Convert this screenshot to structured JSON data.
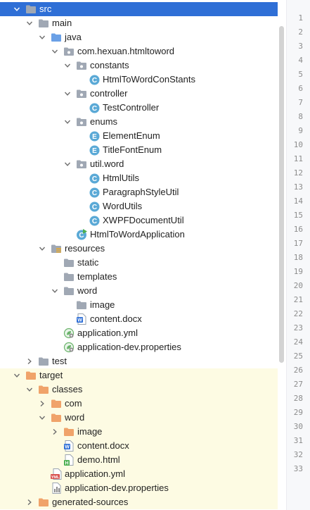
{
  "colors": {
    "selection": "#2f6fd6",
    "excluded_background": "#fdfbe3",
    "folder": "#a0a8b4",
    "source_folder": "#6aa0e6",
    "excluded_folder": "#f0a36a",
    "class_icon": "#5aa9d6",
    "enum_icon": "#5aa9d6",
    "gutter_background": "#f7f8fa",
    "line_number": "#8c8c8c"
  },
  "tree": [
    {
      "label": "src",
      "depth": 0,
      "expanded": true,
      "icon": "folder-icon",
      "state": "selected"
    },
    {
      "label": "main",
      "depth": 1,
      "expanded": true,
      "icon": "folder-icon"
    },
    {
      "label": "java",
      "depth": 2,
      "expanded": true,
      "icon": "source-folder-icon"
    },
    {
      "label": "com.hexuan.htmltoword",
      "depth": 3,
      "expanded": true,
      "icon": "package-icon"
    },
    {
      "label": "constants",
      "depth": 4,
      "expanded": true,
      "icon": "package-icon"
    },
    {
      "label": "HtmlToWordConStants",
      "depth": 5,
      "icon": "class-icon"
    },
    {
      "label": "controller",
      "depth": 4,
      "expanded": true,
      "icon": "package-icon"
    },
    {
      "label": "TestController",
      "depth": 5,
      "icon": "class-icon"
    },
    {
      "label": "enums",
      "depth": 4,
      "expanded": true,
      "icon": "package-icon"
    },
    {
      "label": "ElementEnum",
      "depth": 5,
      "icon": "enum-icon"
    },
    {
      "label": "TitleFontEnum",
      "depth": 5,
      "icon": "enum-icon"
    },
    {
      "label": "util.word",
      "depth": 4,
      "expanded": true,
      "icon": "package-icon"
    },
    {
      "label": "HtmlUtils",
      "depth": 5,
      "icon": "class-icon"
    },
    {
      "label": "ParagraphStyleUtil",
      "depth": 5,
      "icon": "class-icon"
    },
    {
      "label": "WordUtils",
      "depth": 5,
      "icon": "class-icon"
    },
    {
      "label": "XWPFDocumentUtil",
      "depth": 5,
      "icon": "class-icon"
    },
    {
      "label": "HtmlToWordApplication",
      "depth": 4,
      "icon": "spring-boot-class-icon"
    },
    {
      "label": "resources",
      "depth": 2,
      "expanded": true,
      "icon": "resources-folder-icon"
    },
    {
      "label": "static",
      "depth": 3,
      "icon": "folder-icon"
    },
    {
      "label": "templates",
      "depth": 3,
      "icon": "folder-icon"
    },
    {
      "label": "word",
      "depth": 3,
      "expanded": true,
      "icon": "folder-icon"
    },
    {
      "label": "image",
      "depth": 4,
      "icon": "folder-icon"
    },
    {
      "label": "content.docx",
      "depth": 4,
      "icon": "word-file-icon"
    },
    {
      "label": "application.yml",
      "depth": 3,
      "icon": "spring-config-icon"
    },
    {
      "label": "application-dev.properties",
      "depth": 3,
      "icon": "spring-config-icon"
    },
    {
      "label": "test",
      "depth": 1,
      "expanded": false,
      "icon": "folder-icon"
    },
    {
      "label": "target",
      "depth": 0,
      "expanded": true,
      "icon": "excluded-folder-icon",
      "state": "excluded"
    },
    {
      "label": "classes",
      "depth": 1,
      "expanded": true,
      "icon": "excluded-folder-icon",
      "state": "excluded"
    },
    {
      "label": "com",
      "depth": 2,
      "expanded": false,
      "icon": "excluded-folder-icon",
      "state": "excluded"
    },
    {
      "label": "word",
      "depth": 2,
      "expanded": true,
      "icon": "excluded-folder-icon",
      "state": "excluded"
    },
    {
      "label": "image",
      "depth": 3,
      "expanded": false,
      "icon": "excluded-folder-icon",
      "state": "excluded"
    },
    {
      "label": "content.docx",
      "depth": 3,
      "icon": "word-file-icon",
      "state": "excluded"
    },
    {
      "label": "demo.html",
      "depth": 3,
      "icon": "html-file-icon",
      "state": "excluded"
    },
    {
      "label": "application.yml",
      "depth": 2,
      "icon": "yml-file-icon",
      "state": "excluded"
    },
    {
      "label": "application-dev.properties",
      "depth": 2,
      "icon": "properties-file-icon",
      "state": "excluded"
    },
    {
      "label": "generated-sources",
      "depth": 1,
      "expanded": false,
      "icon": "excluded-folder-icon",
      "state": "excluded"
    }
  ],
  "line_numbers": [
    "1",
    "2",
    "3",
    "4",
    "5",
    "6",
    "7",
    "8",
    "9",
    "10",
    "11",
    "12",
    "13",
    "14",
    "15",
    "16",
    "17",
    "18",
    "19",
    "20",
    "21",
    "22",
    "23",
    "24",
    "25",
    "26",
    "27",
    "28",
    "29",
    "30",
    "31",
    "32",
    "33"
  ]
}
